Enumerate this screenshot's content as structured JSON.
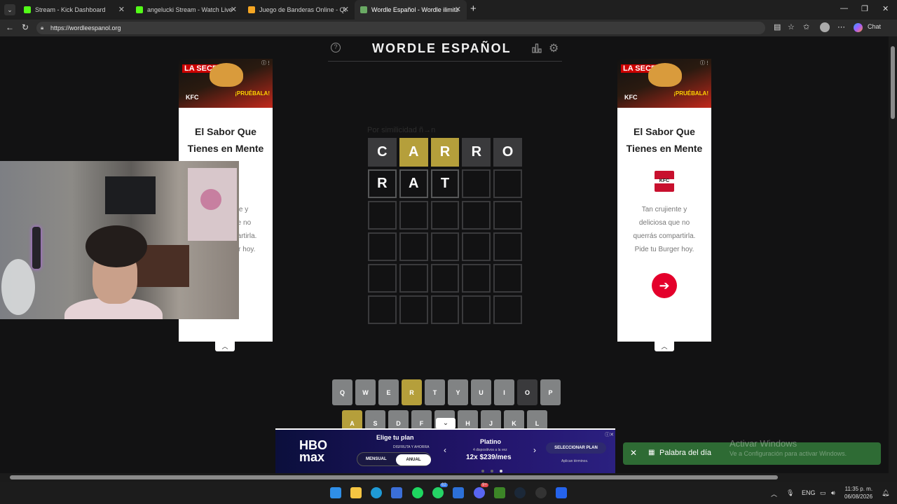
{
  "browser": {
    "tabs": [
      {
        "title": "Stream - Kick Dashboard",
        "favicon_color": "#53fc18",
        "active": false
      },
      {
        "title": "angelucki Stream - Watch Live on Kick",
        "favicon_color": "#53fc18",
        "active": false
      },
      {
        "title": "Juego de Banderas Online - Quiz de",
        "favicon_color": "#f5a623",
        "active": false
      },
      {
        "title": "Wordle Español - Wordle ilimitado",
        "favicon_color": "#6aaa64",
        "active": true
      }
    ],
    "url": "https://wordleespanol.org",
    "chat_label": "Chat"
  },
  "game": {
    "title": "WORDLE ESPAÑOL",
    "hint": "Por similicidad ñ→n",
    "rows": [
      [
        {
          "l": "C",
          "s": "absent"
        },
        {
          "l": "A",
          "s": "present"
        },
        {
          "l": "R",
          "s": "present"
        },
        {
          "l": "R",
          "s": "absent"
        },
        {
          "l": "O",
          "s": "absent"
        }
      ],
      [
        {
          "l": "R",
          "s": "filled"
        },
        {
          "l": "A",
          "s": "filled"
        },
        {
          "l": "T",
          "s": "filled"
        },
        {
          "l": "",
          "s": "empty"
        },
        {
          "l": "",
          "s": "empty"
        }
      ],
      [
        {
          "l": "",
          "s": "empty"
        },
        {
          "l": "",
          "s": "empty"
        },
        {
          "l": "",
          "s": "empty"
        },
        {
          "l": "",
          "s": "empty"
        },
        {
          "l": "",
          "s": "empty"
        }
      ],
      [
        {
          "l": "",
          "s": "empty"
        },
        {
          "l": "",
          "s": "empty"
        },
        {
          "l": "",
          "s": "empty"
        },
        {
          "l": "",
          "s": "empty"
        },
        {
          "l": "",
          "s": "empty"
        }
      ],
      [
        {
          "l": "",
          "s": "empty"
        },
        {
          "l": "",
          "s": "empty"
        },
        {
          "l": "",
          "s": "empty"
        },
        {
          "l": "",
          "s": "empty"
        },
        {
          "l": "",
          "s": "empty"
        }
      ],
      [
        {
          "l": "",
          "s": "empty"
        },
        {
          "l": "",
          "s": "empty"
        },
        {
          "l": "",
          "s": "empty"
        },
        {
          "l": "",
          "s": "empty"
        },
        {
          "l": "",
          "s": "empty"
        }
      ]
    ],
    "keyboard": {
      "row1": [
        {
          "k": "Q",
          "s": "unused"
        },
        {
          "k": "W",
          "s": "unused"
        },
        {
          "k": "E",
          "s": "unused"
        },
        {
          "k": "R",
          "s": "present"
        },
        {
          "k": "T",
          "s": "unused"
        },
        {
          "k": "Y",
          "s": "unused"
        },
        {
          "k": "U",
          "s": "unused"
        },
        {
          "k": "I",
          "s": "unused"
        },
        {
          "k": "O",
          "s": "absent"
        },
        {
          "k": "P",
          "s": "unused"
        }
      ],
      "row2": [
        {
          "k": "A",
          "s": "present"
        },
        {
          "k": "S",
          "s": "unused"
        },
        {
          "k": "D",
          "s": "unused"
        },
        {
          "k": "F",
          "s": "unused"
        },
        {
          "k": "G",
          "s": "unused"
        },
        {
          "k": "H",
          "s": "unused"
        },
        {
          "k": "J",
          "s": "unused"
        },
        {
          "k": "K",
          "s": "unused"
        },
        {
          "k": "L",
          "s": "unused"
        }
      ]
    }
  },
  "side_ads": {
    "banner_tag": "LA SECRETA",
    "banner_cta": "¡PRUÉBALA!",
    "banner_brand": "KFC",
    "heading": "El Sabor Que Tienes en Mente",
    "logo": "KFC",
    "body": "Tan crujiente y deliciosa que no querrás compartirla. Pide tu Burger hoy.",
    "cta_arrow": "➔"
  },
  "hbo_ad": {
    "logo_line1": "HBO",
    "logo_line2": "max",
    "title": "Elige tu plan",
    "sub": "DISFRUTA Y AHORRA",
    "tab_monthly": "MENSUAL",
    "tab_annual": "ANUAL",
    "plan": "Platino",
    "plan_detail": "4 dispositivos a la vez",
    "price": "12x $239/mes",
    "select_button": "SELECCIONAR PLAN",
    "terms": "Aplican términos."
  },
  "toast": {
    "label": "Palabra del día"
  },
  "watermark": {
    "line1": "Activar Windows",
    "line2": "Ve a Configuración para activar Windows."
  },
  "taskbar": {
    "lang": "ENG",
    "time": "11:35 p. m.",
    "date": "06/08/2026",
    "badge_whatsapp": "62",
    "badge_discord": "9+"
  },
  "colors": {
    "present": "#b59f3b",
    "absent": "#3a3a3c",
    "key": "#818384",
    "background": "#121213"
  }
}
